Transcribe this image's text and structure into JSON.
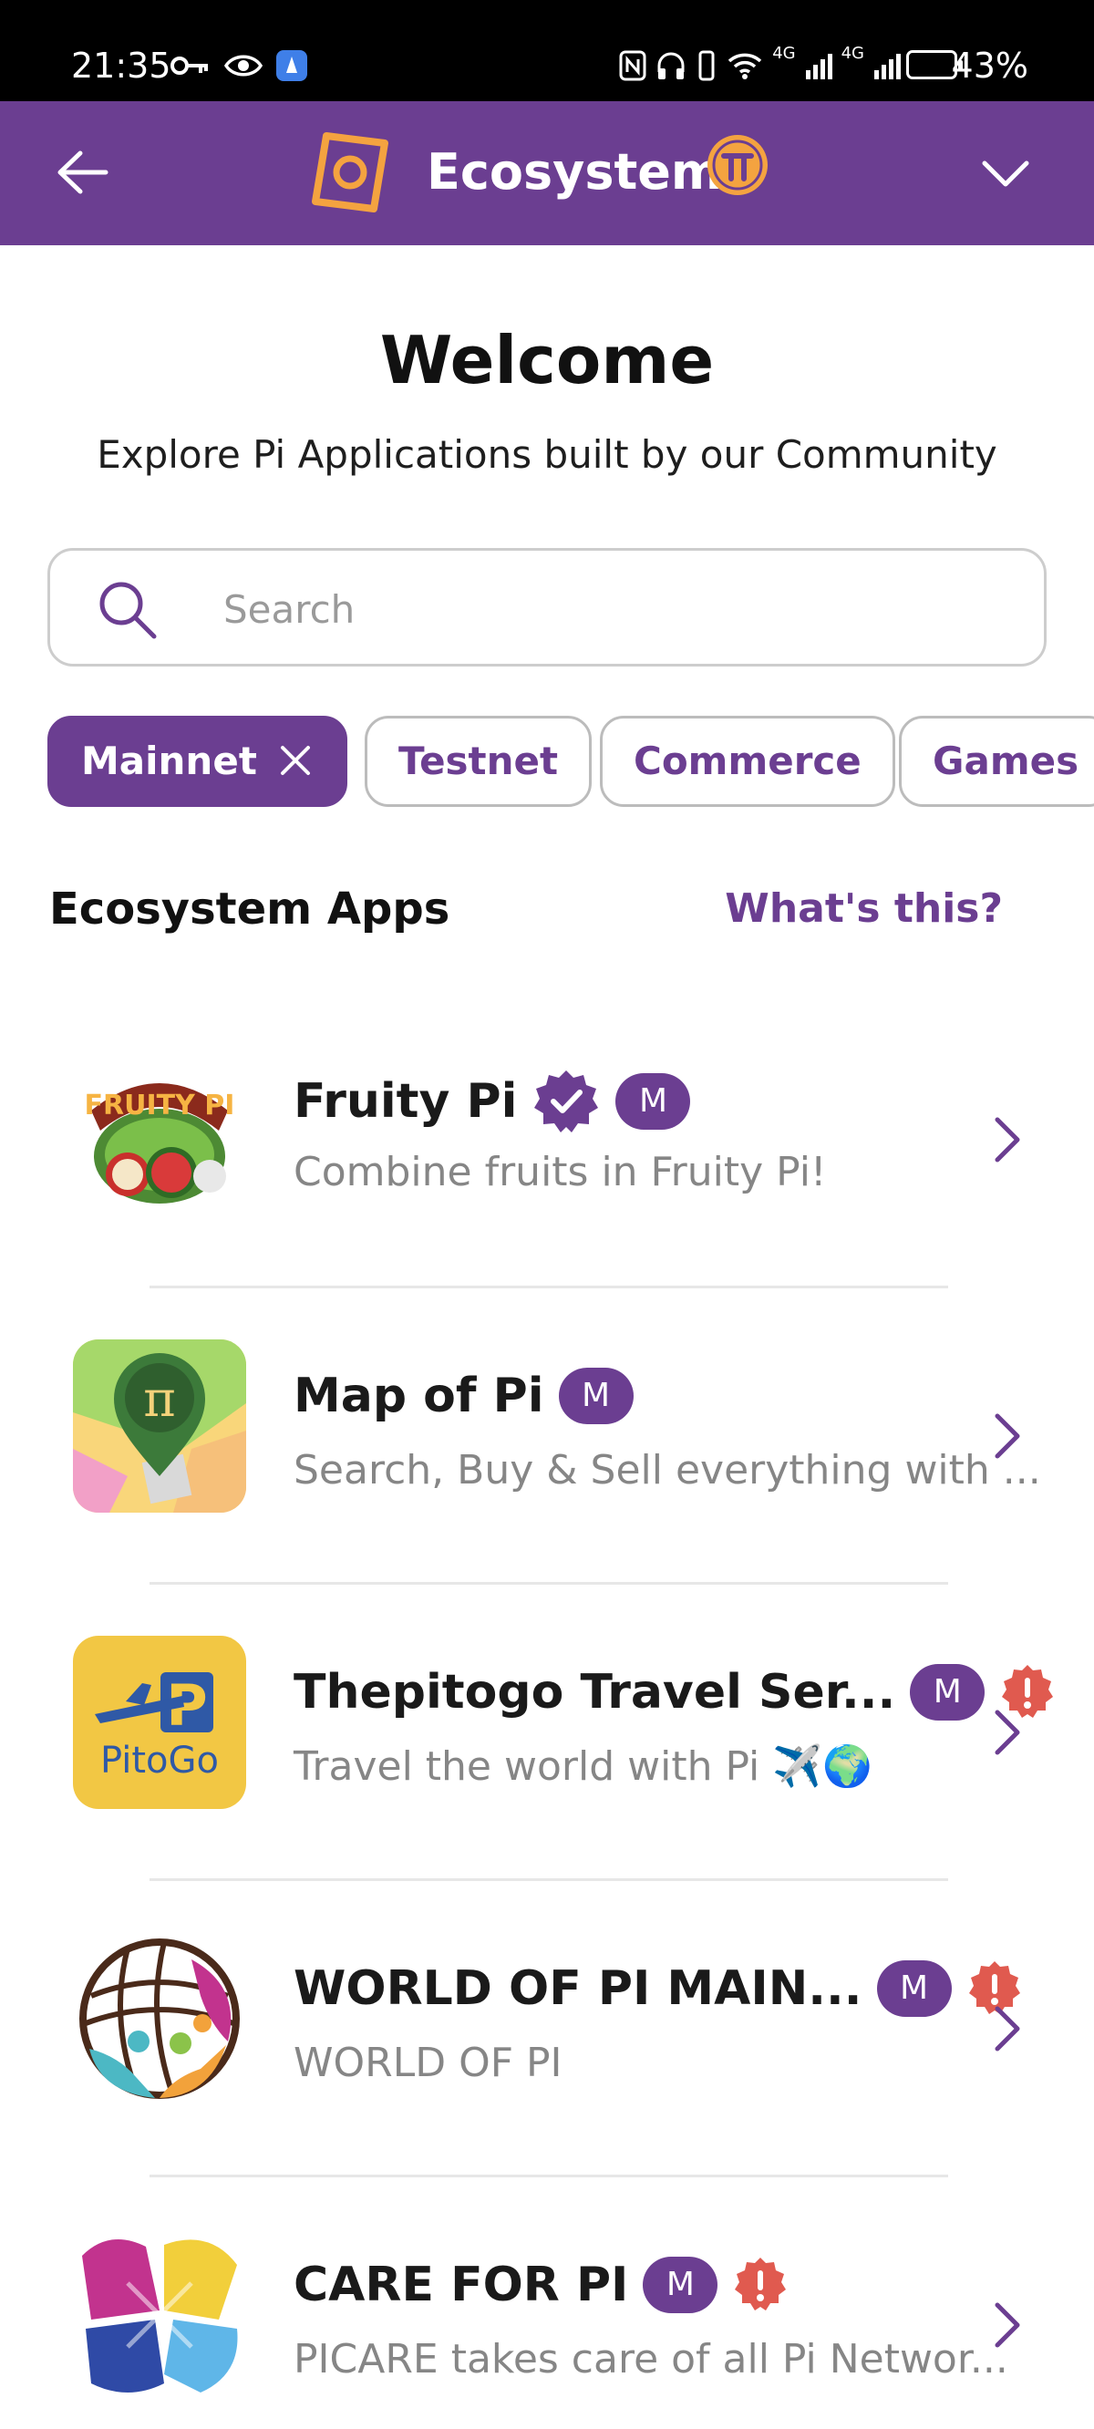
{
  "status_bar": {
    "time": "21:35",
    "battery": "43%",
    "network": "4G"
  },
  "header": {
    "title": "Ecosystem"
  },
  "welcome": {
    "title": "Welcome",
    "subtitle": "Explore Pi Applications built by our Community"
  },
  "search": {
    "placeholder": "Search",
    "value": ""
  },
  "filters": [
    {
      "label": "Mainnet",
      "active": true
    },
    {
      "label": "Testnet",
      "active": false
    },
    {
      "label": "Commerce",
      "active": false
    },
    {
      "label": "Games",
      "active": false
    }
  ],
  "section": {
    "title": "Ecosystem Apps",
    "link": "What's this?"
  },
  "apps": [
    {
      "name": "Fruity Pi",
      "description": "Combine fruits in Fruity Pi!",
      "badge": "M",
      "verified": true,
      "warning": false
    },
    {
      "name": "Map of Pi",
      "description": "Search, Buy & Sell everything with ...",
      "badge": "M",
      "verified": false,
      "warning": false
    },
    {
      "name": "Thepitogo Travel Ser...",
      "description": "Travel the world with Pi ✈️🌍",
      "badge": "M",
      "verified": false,
      "warning": true
    },
    {
      "name": "WORLD OF PI MAIN...",
      "description": "WORLD OF PI",
      "badge": "M",
      "verified": false,
      "warning": true
    },
    {
      "name": "CARE FOR PI",
      "description": "PICARE takes care of all Pi Networ...",
      "badge": "M",
      "verified": false,
      "warning": true
    }
  ],
  "colors": {
    "brand_purple": "#6b3e91",
    "accent_orange": "#f4a340",
    "warning_red": "#e05a4f"
  },
  "icons": {
    "back": "arrow-left-icon",
    "logo": "ecosystem-logo-icon",
    "pi": "pi-coin-icon",
    "menu": "chevron-down-icon",
    "search": "search-icon",
    "remove_filter": "close-icon",
    "open_app": "chevron-right-icon"
  },
  "app_icon_text": {
    "fruity_pi": "FRUITY PI",
    "map_of_pi": "π",
    "pitogo": "PitoGo"
  }
}
